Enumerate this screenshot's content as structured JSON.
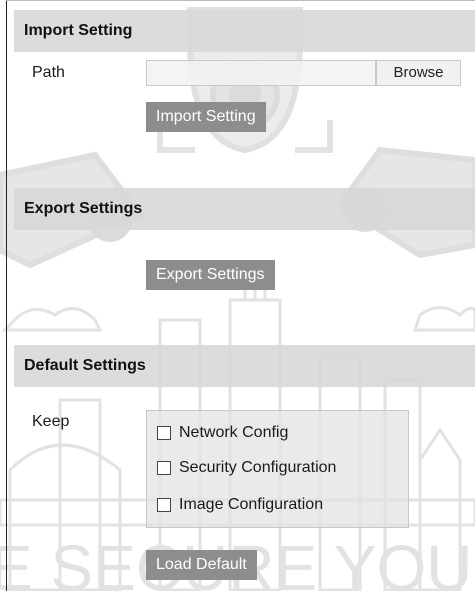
{
  "import": {
    "title": "Import Setting",
    "path_label": "Path",
    "path_value": "",
    "browse_label": "Browse",
    "import_button_label": "Import Setting"
  },
  "export": {
    "title": "Export Settings",
    "export_button_label": "Export Settings"
  },
  "defaults": {
    "title": "Default Settings",
    "keep_label": "Keep",
    "options": [
      {
        "label": "Network Config",
        "checked": false
      },
      {
        "label": "Security Configuration",
        "checked": false
      },
      {
        "label": "Image Configuration",
        "checked": false
      }
    ],
    "load_button_label": "Load Default"
  },
  "watermark": {
    "text": "E SECURE YOUR L"
  }
}
